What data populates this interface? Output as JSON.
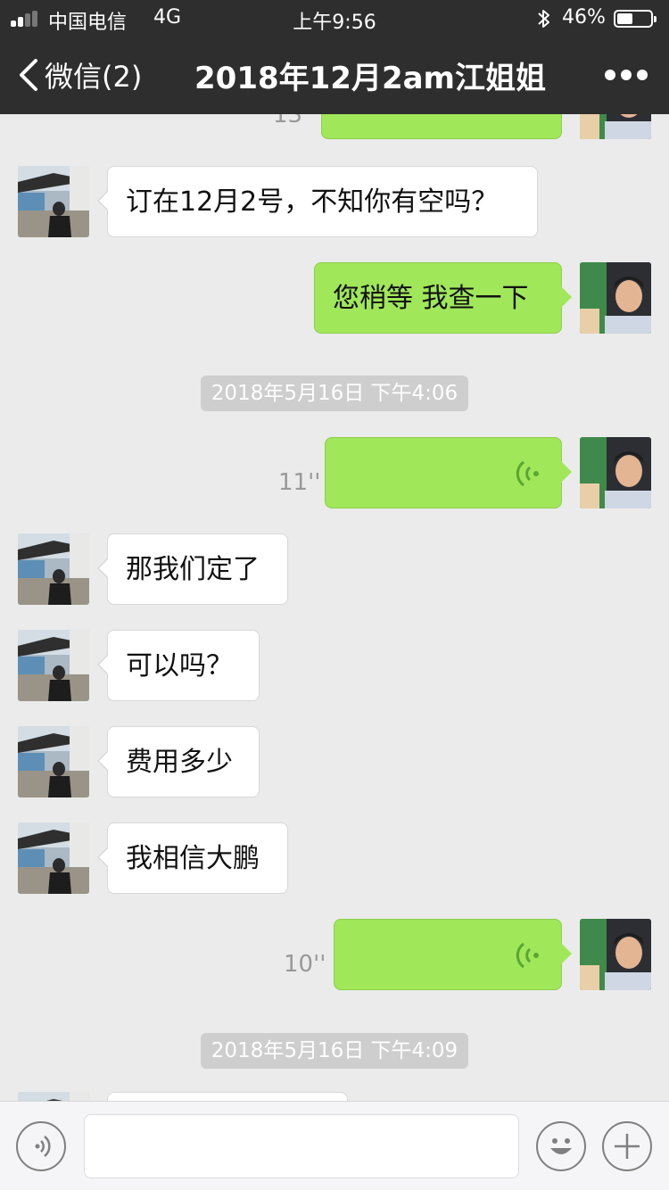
{
  "status_bar": {
    "carrier": "中国电信",
    "network": "4G",
    "time": "上午9:56",
    "battery_percent": "46%",
    "battery_level": 0.46,
    "signal_bars_active": 2,
    "signal_bars_total": 4
  },
  "nav": {
    "back_label": "微信(2)",
    "title": "2018年12月2am江姐姐"
  },
  "messages": {
    "partial_top_duration": "13''",
    "m1": {
      "text": "订在12月2号，不知你有空吗？"
    },
    "m2": {
      "text": "您稍等 我查一下"
    },
    "t1": "2018年5月16日 下午4:06",
    "v1": {
      "duration": "11''"
    },
    "m3": {
      "text": "那我们定了"
    },
    "m4": {
      "text": "可以吗？"
    },
    "m5": {
      "text": "费用多少"
    },
    "m6": {
      "text": "我相信大鹏"
    },
    "v2": {
      "duration": "10''"
    },
    "t2": "2018年5月16日 下午4:09"
  },
  "input_bar": {
    "value": "",
    "placeholder": ""
  },
  "icons": {
    "back": "chevron-left-icon",
    "more": "more-dots-icon",
    "voice_toggle": "voice-icon",
    "emoji": "emoji-icon",
    "plus": "plus-icon",
    "bluetooth": "bluetooth-icon"
  },
  "colors": {
    "nav_bg": "#2e2e2e",
    "chat_bg": "#ebebeb",
    "outgoing_bubble": "#a0e75a",
    "incoming_bubble": "#ffffff",
    "timestamp_pill": "#cecece"
  }
}
